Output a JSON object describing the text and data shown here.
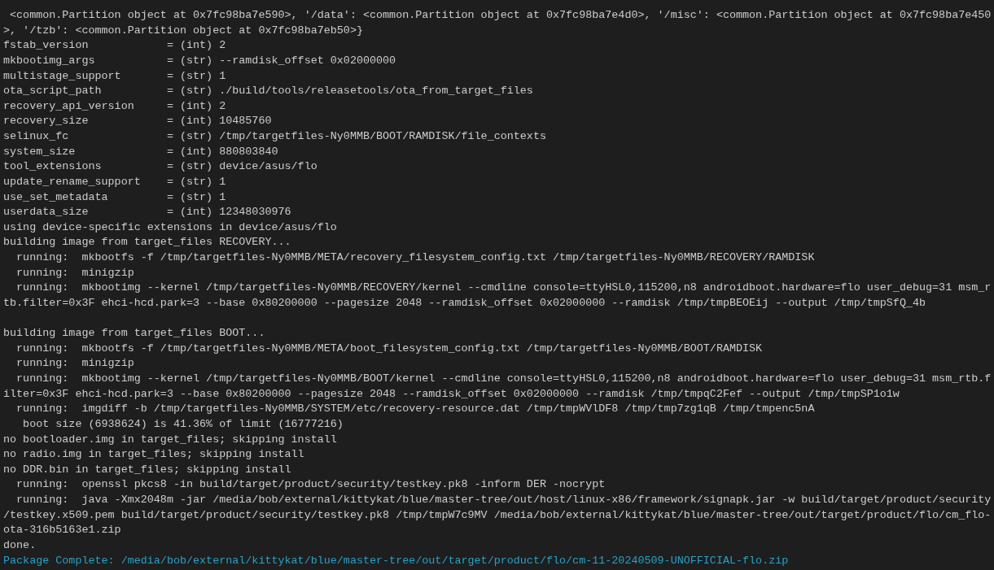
{
  "terminal": {
    "lines": [
      {
        "kind": "output",
        "text": " <common.Partition object at 0x7fc98ba7e590>, '/data': <common.Partition object at 0x7fc98ba7e4d0>, '/misc': <common.Partition object at 0x7fc98ba7e450"
      },
      {
        "kind": "output",
        "text": ">, '/tzb': <common.Partition object at 0x7fc98ba7eb50>}"
      },
      {
        "kind": "output",
        "text": "fstab_version            = (int) 2"
      },
      {
        "kind": "output",
        "text": "mkbootimg_args           = (str) --ramdisk_offset 0x02000000"
      },
      {
        "kind": "output",
        "text": "multistage_support       = (str) 1"
      },
      {
        "kind": "output",
        "text": "ota_script_path          = (str) ./build/tools/releasetools/ota_from_target_files"
      },
      {
        "kind": "output",
        "text": "recovery_api_version     = (int) 2"
      },
      {
        "kind": "output",
        "text": "recovery_size            = (int) 10485760"
      },
      {
        "kind": "output",
        "text": "selinux_fc               = (str) /tmp/targetfiles-Ny0MMB/BOOT/RAMDISK/file_contexts"
      },
      {
        "kind": "output",
        "text": "system_size              = (int) 880803840"
      },
      {
        "kind": "output",
        "text": "tool_extensions          = (str) device/asus/flo"
      },
      {
        "kind": "output",
        "text": "update_rename_support    = (str) 1"
      },
      {
        "kind": "output",
        "text": "use_set_metadata         = (str) 1"
      },
      {
        "kind": "output",
        "text": "userdata_size            = (int) 12348030976"
      },
      {
        "kind": "output",
        "text": "using device-specific extensions in device/asus/flo"
      },
      {
        "kind": "output",
        "text": "building image from target_files RECOVERY..."
      },
      {
        "kind": "output",
        "text": "  running:  mkbootfs -f /tmp/targetfiles-Ny0MMB/META/recovery_filesystem_config.txt /tmp/targetfiles-Ny0MMB/RECOVERY/RAMDISK"
      },
      {
        "kind": "output",
        "text": "  running:  minigzip"
      },
      {
        "kind": "output",
        "text": "  running:  mkbootimg --kernel /tmp/targetfiles-Ny0MMB/RECOVERY/kernel --cmdline console=ttyHSL0,115200,n8 androidboot.hardware=flo user_debug=31 msm_r"
      },
      {
        "kind": "output",
        "text": "tb.filter=0x3F ehci-hcd.park=3 --base 0x80200000 --pagesize 2048 --ramdisk_offset 0x02000000 --ramdisk /tmp/tmpBEOEij --output /tmp/tmpSfQ_4b"
      },
      {
        "kind": "blank"
      },
      {
        "kind": "output",
        "text": "building image from target_files BOOT..."
      },
      {
        "kind": "output",
        "text": "  running:  mkbootfs -f /tmp/targetfiles-Ny0MMB/META/boot_filesystem_config.txt /tmp/targetfiles-Ny0MMB/BOOT/RAMDISK"
      },
      {
        "kind": "output",
        "text": "  running:  minigzip"
      },
      {
        "kind": "output",
        "text": "  running:  mkbootimg --kernel /tmp/targetfiles-Ny0MMB/BOOT/kernel --cmdline console=ttyHSL0,115200,n8 androidboot.hardware=flo user_debug=31 msm_rtb.f"
      },
      {
        "kind": "output",
        "text": "ilter=0x3F ehci-hcd.park=3 --base 0x80200000 --pagesize 2048 --ramdisk_offset 0x02000000 --ramdisk /tmp/tmpqC2Fef --output /tmp/tmpSP1o1w"
      },
      {
        "kind": "output",
        "text": "  running:  imgdiff -b /tmp/targetfiles-Ny0MMB/SYSTEM/etc/recovery-resource.dat /tmp/tmpWVlDF8 /tmp/tmp7zg1qB /tmp/tmpenc5nA"
      },
      {
        "kind": "output",
        "text": "   boot size (6938624) is 41.36% of limit (16777216)"
      },
      {
        "kind": "output",
        "text": "no bootloader.img in target_files; skipping install"
      },
      {
        "kind": "output",
        "text": "no radio.img in target_files; skipping install"
      },
      {
        "kind": "output",
        "text": "no DDR.bin in target_files; skipping install"
      },
      {
        "kind": "output",
        "text": "  running:  openssl pkcs8 -in build/target/product/security/testkey.pk8 -inform DER -nocrypt"
      },
      {
        "kind": "output",
        "text": "  running:  java -Xmx2048m -jar /media/bob/external/kittykat/blue/master-tree/out/host/linux-x86/framework/signapk.jar -w build/target/product/security"
      },
      {
        "kind": "output",
        "text": "/testkey.x509.pem build/target/product/security/testkey.pk8 /tmp/tmpW7c9MV /media/bob/external/kittykat/blue/master-tree/out/target/product/flo/cm_flo-"
      },
      {
        "kind": "output",
        "text": "ota-316b5163e1.zip"
      },
      {
        "kind": "output",
        "text": "done."
      },
      {
        "kind": "highlight",
        "text": "Package Complete: /media/bob/external/kittykat/blue/master-tree/out/target/product/flo/cm-11-20240509-UNOFFICIAL-flo.zip"
      }
    ]
  }
}
